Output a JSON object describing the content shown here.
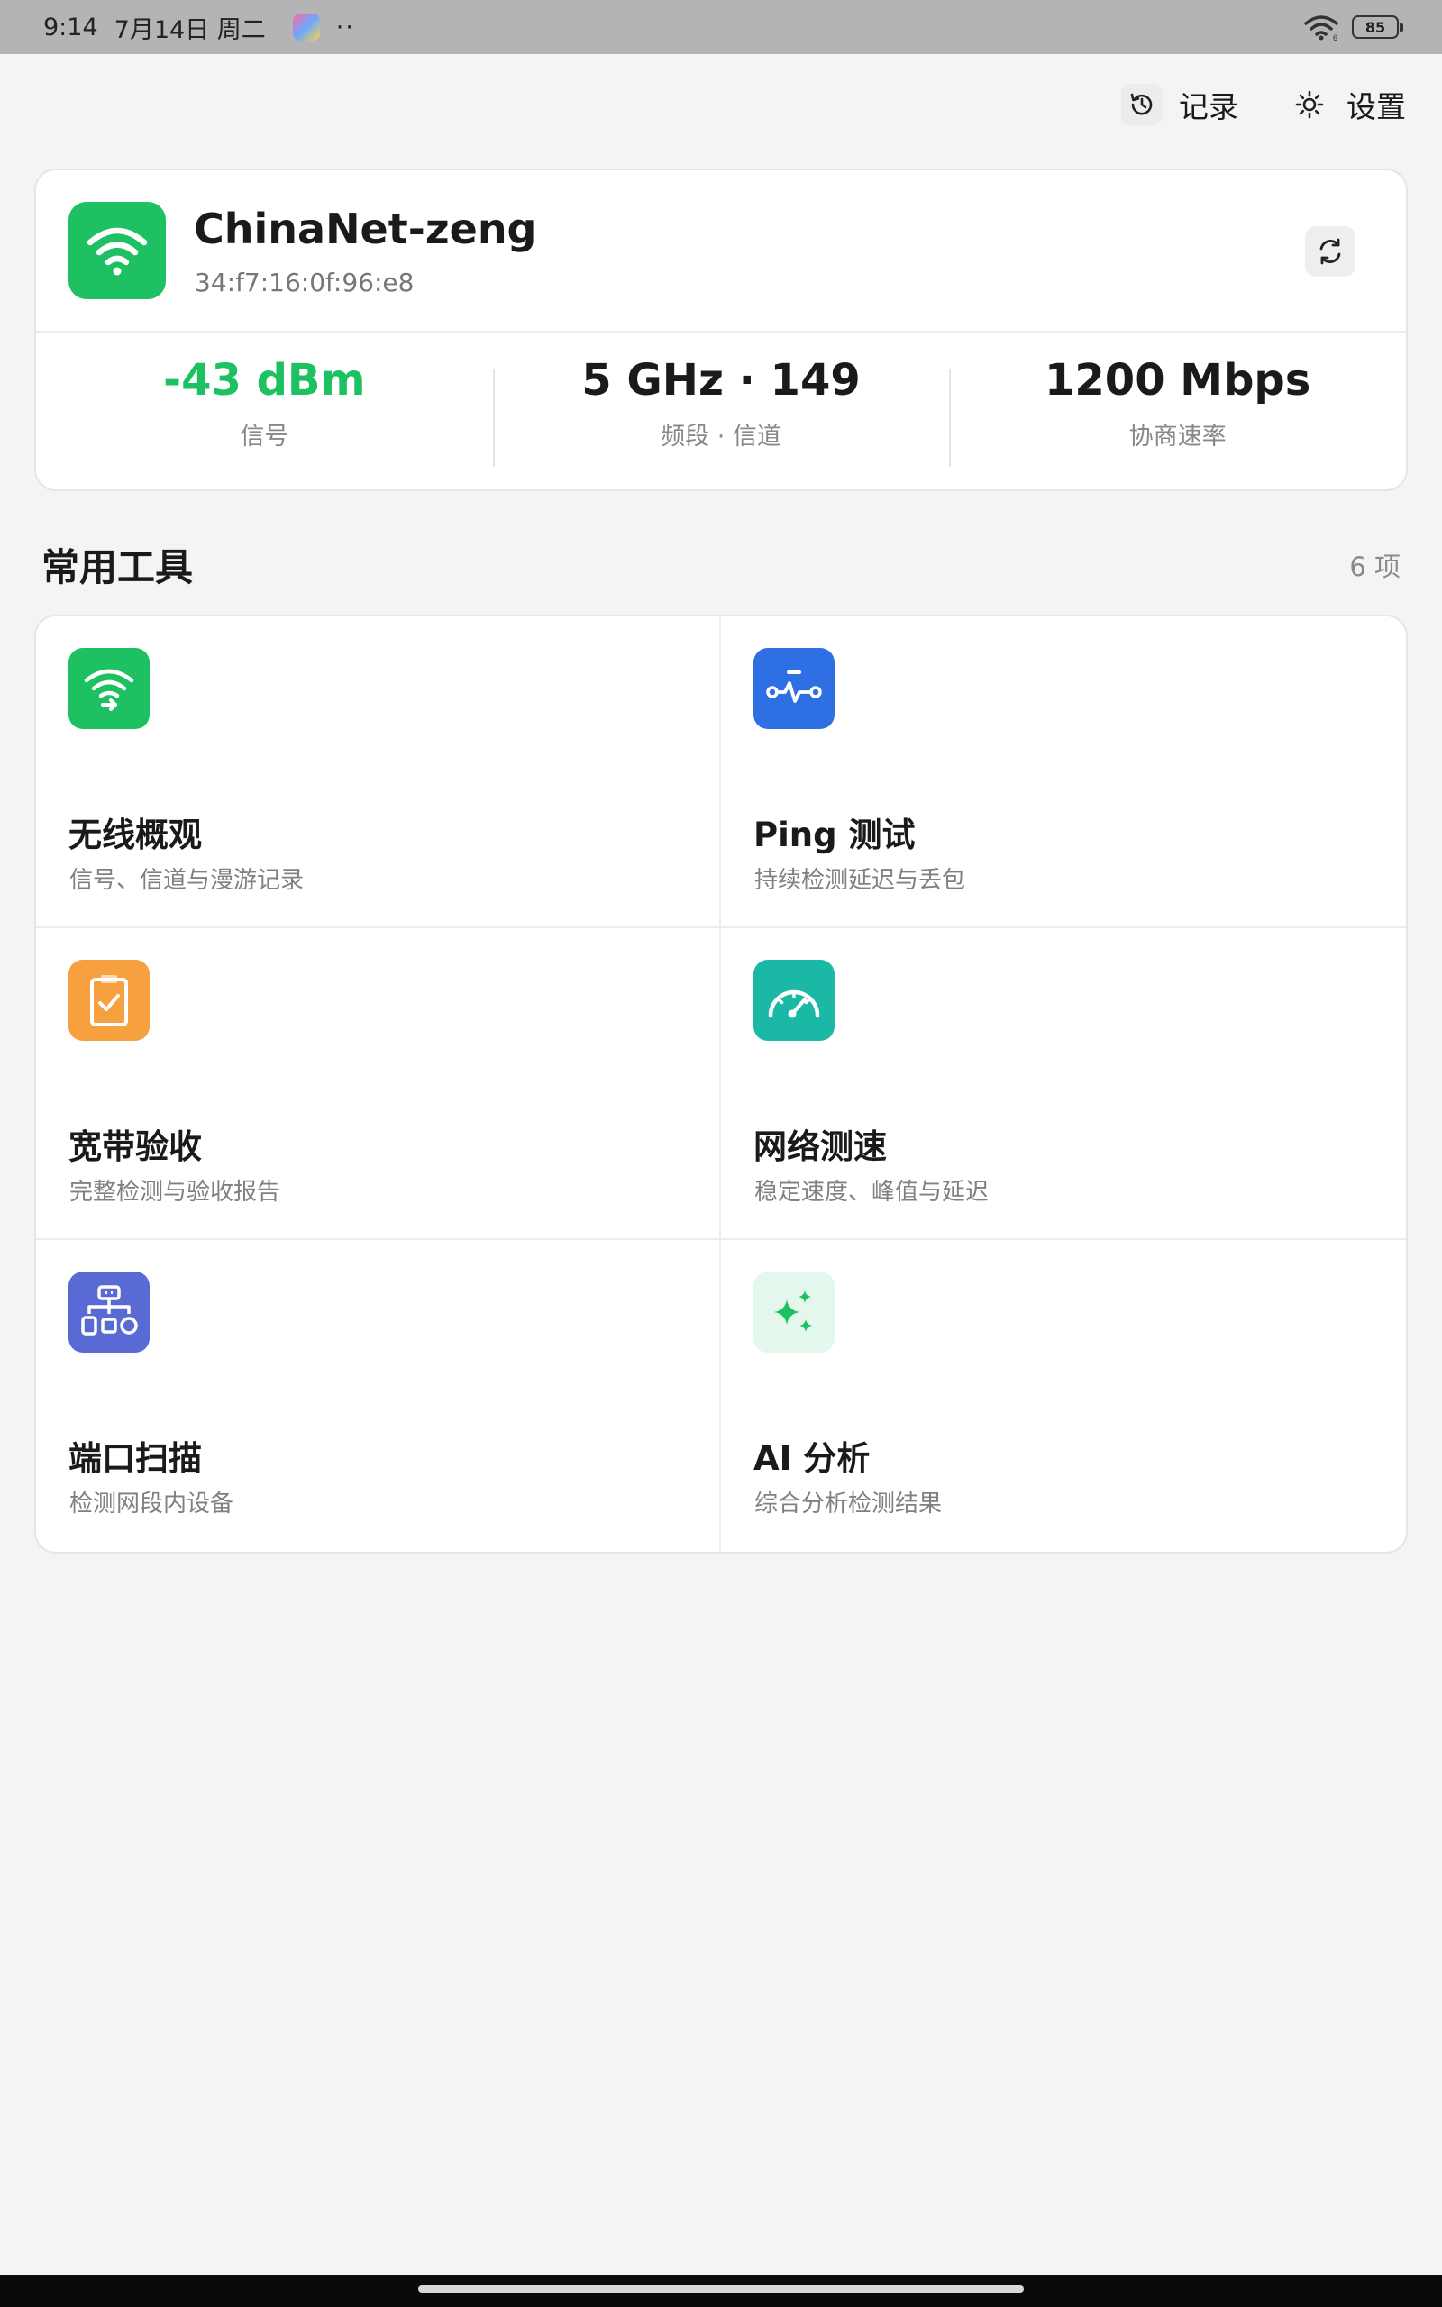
{
  "status_bar": {
    "time": "9:14",
    "date": "7月14日 周二",
    "dots": "··",
    "battery": "85"
  },
  "header": {
    "history_label": "记录",
    "settings_label": "设置"
  },
  "network": {
    "ssid": "ChinaNet-zeng",
    "bssid": "34:f7:16:0f:96:e8",
    "stats": [
      {
        "value": "-43 dBm",
        "label": "信号",
        "color": "#1ec162"
      },
      {
        "value": "5 GHz · 149",
        "label": "频段 · 信道"
      },
      {
        "value": "1200 Mbps",
        "label": "协商速率"
      }
    ]
  },
  "tools_section": {
    "title": "常用工具",
    "count": "6 项",
    "items": [
      {
        "name": "无线概观",
        "desc": "信号、信道与漫游记录",
        "icon": "wifi-icon",
        "color": "#1ec162"
      },
      {
        "name": "Ping 测试",
        "desc": "持续检测延迟与丢包",
        "icon": "pulse-icon",
        "color": "#2f6fe4"
      },
      {
        "name": "宽带验收",
        "desc": "完整检测与验收报告",
        "icon": "clipboard-check-icon",
        "color": "#f7a03f"
      },
      {
        "name": "网络测速",
        "desc": "稳定速度、峰值与延迟",
        "icon": "speedometer-icon",
        "color": "#1bb8a6"
      },
      {
        "name": "端口扫描",
        "desc": "检测网段内设备",
        "icon": "network-topology-icon",
        "color": "#5a6ad4"
      },
      {
        "name": "AI 分析",
        "desc": "综合分析检测结果",
        "icon": "sparkles-icon",
        "color": "#e4f7ec"
      }
    ]
  }
}
